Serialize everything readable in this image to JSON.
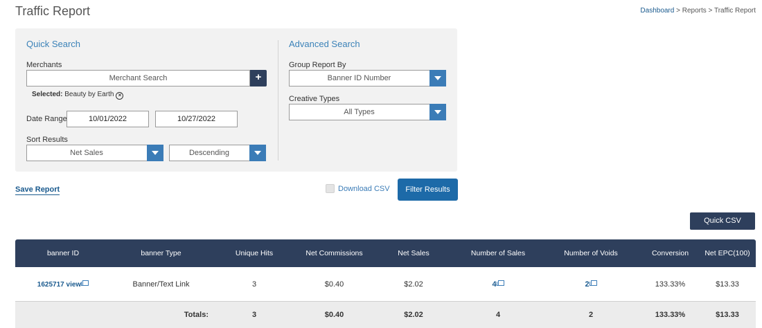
{
  "header": {
    "title": "Traffic Report",
    "breadcrumb": {
      "dashboard": "Dashboard",
      "sep1": " > ",
      "reports": "Reports",
      "sep2": " > ",
      "current": "Traffic Report"
    }
  },
  "quick_search": {
    "heading": "Quick Search",
    "merchants_label": "Merchants",
    "merchant_placeholder": "Merchant Search",
    "add_icon": "+",
    "selected_label": "Selected:",
    "selected_value": "Beauty by Earth",
    "remove_icon": "×",
    "date_range_label": "Date Range",
    "date_from": "10/01/2022",
    "date_to": "10/27/2022",
    "sort_label": "Sort Results",
    "sort_by": "Net Sales",
    "sort_order": "Descending"
  },
  "advanced_search": {
    "heading": "Advanced Search",
    "group_label": "Group Report By",
    "group_value": "Banner ID Number",
    "creative_label": "Creative Types",
    "creative_value": "All Types"
  },
  "actions": {
    "save_report": "Save Report",
    "download_csv": "Download CSV",
    "filter_results": "Filter Results",
    "quick_csv": "Quick CSV"
  },
  "table": {
    "columns": [
      "banner ID",
      "banner Type",
      "Unique Hits",
      "Net Commissions",
      "Net Sales",
      "Number of Sales",
      "Number of Voids",
      "Conversion",
      "Net EPC(100)"
    ],
    "rows": [
      {
        "banner_id": "1625717 view",
        "banner_type": "Banner/Text Link",
        "unique_hits": "3",
        "net_commissions": "$0.40",
        "net_sales": "$2.02",
        "number_of_sales": "4",
        "number_of_voids": "2",
        "conversion": "133.33%",
        "net_epc": "$13.33"
      }
    ],
    "totals": {
      "label": "Totals:",
      "unique_hits": "3",
      "net_commissions": "$0.40",
      "net_sales": "$2.02",
      "number_of_sales": "4",
      "number_of_voids": "2",
      "conversion": "133.33%",
      "net_epc": "$13.33"
    }
  },
  "colors": {
    "header_bg": "#2e3f5c",
    "accent_blue": "#3b7cb7",
    "link": "#1a5a8e",
    "panel_bg": "#f2f2f2"
  }
}
